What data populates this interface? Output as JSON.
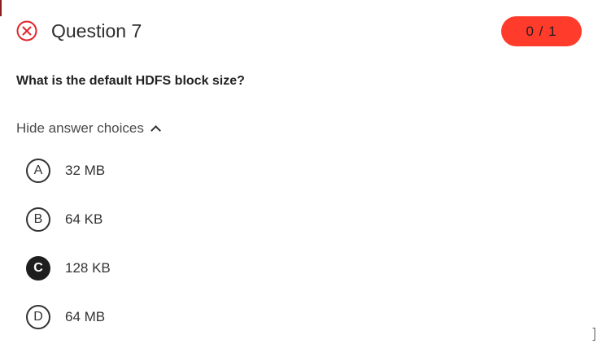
{
  "question": {
    "title": "Question 7",
    "score": "0 / 1",
    "status": "incorrect",
    "text": "What is the default HDFS block size?"
  },
  "toggle": {
    "label": "Hide answer choices",
    "icon": "chevron-up-icon"
  },
  "choices": [
    {
      "letter": "A",
      "text": "32 MB",
      "selected": false
    },
    {
      "letter": "B",
      "text": "64 KB",
      "selected": false
    },
    {
      "letter": "C",
      "text": "128 KB",
      "selected": true
    },
    {
      "letter": "D",
      "text": "64 MB",
      "selected": false
    }
  ],
  "colors": {
    "incorrect": "#e0262b",
    "score_badge": "#ff3b2b",
    "selected_choice": "#1e1e1e"
  }
}
